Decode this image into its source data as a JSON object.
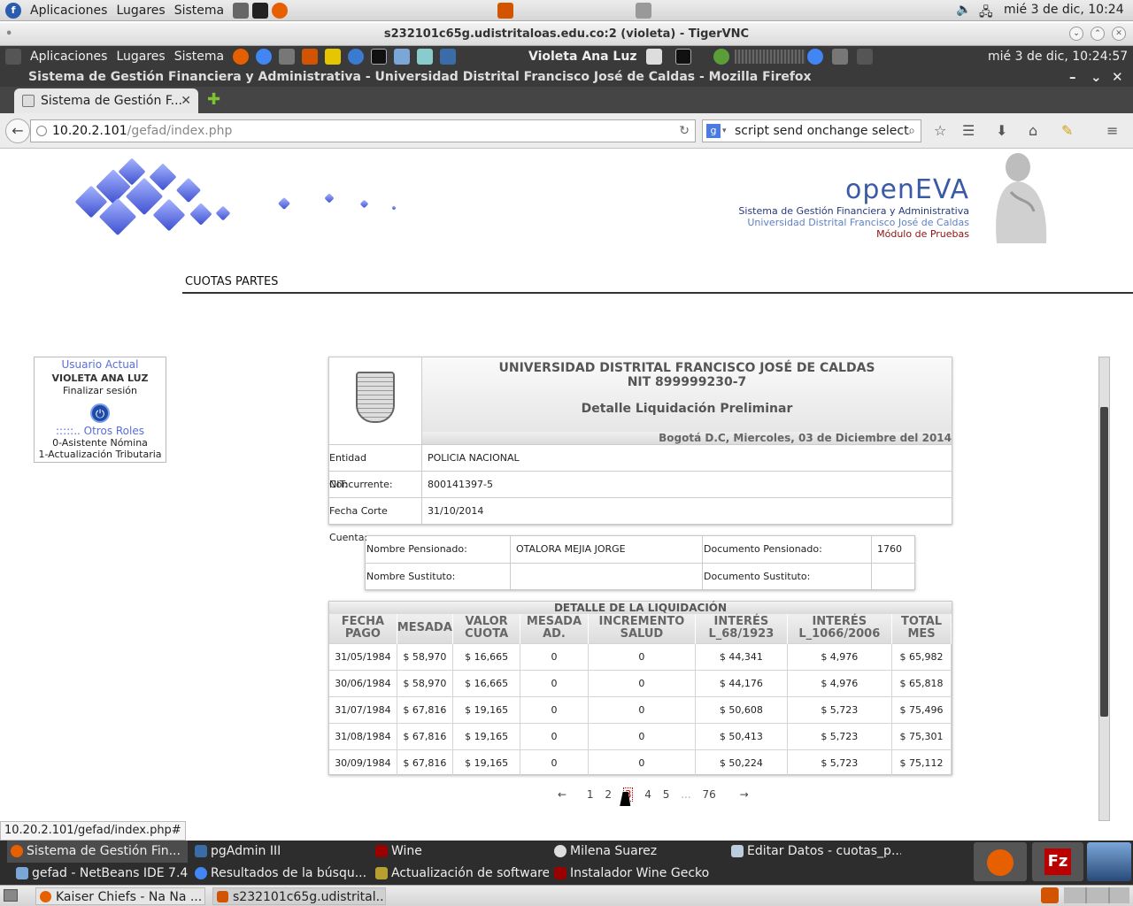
{
  "system_top_panel": {
    "menus": [
      "Aplicaciones",
      "Lugares",
      "Sistema"
    ],
    "clock": "mié  3 de dic, 10:24"
  },
  "vnc_window": {
    "title": "s232101c65g.udistritaloas.edu.co:2 (violeta) - TigerVNC"
  },
  "remote_panel": {
    "menus": [
      "Aplicaciones",
      "Lugares",
      "Sistema"
    ],
    "user": "Violeta Ana Luz",
    "clock": "mié  3 de dic, 10:24:57"
  },
  "firefox": {
    "window_title": "Sistema de Gestión Financiera y Administrativa - Universidad Distrital Francisco José de Caldas - Mozilla Firefox",
    "tab_label": "Sistema de Gestión F...",
    "url_host": "10.20.2.101",
    "url_path": "/gefad/index.php",
    "search_value": "script send onchange select",
    "status_url": "10.20.2.101/gefad/index.php#"
  },
  "page": {
    "brand": {
      "name": "openEVA",
      "line1": "Sistema de Gestión Financiera y Administrativa",
      "line2": "Universidad Distrital Francisco José de Caldas",
      "line3": "Módulo de Pruebas"
    },
    "section_title": "CUOTAS PARTES",
    "user_box": {
      "heading": "Usuario Actual",
      "name": "VIOLETA ANA LUZ",
      "logout": "Finalizar sesión",
      "roles_heading": ":::::.. Otros Roles",
      "roles": [
        "0-Asistente Nómina",
        "1-Actualización Tributaria"
      ]
    },
    "report": {
      "university": "UNIVERSIDAD DISTRITAL FRANCISCO JOSÉ DE CALDAS",
      "nit_line": "NIT 899999230-7",
      "subtitle": "Detalle Liquidación Preliminar",
      "date_line": "Bogotá D.C, Miercoles, 03 de Diciembre del 2014",
      "fields": [
        {
          "label": "Entidad Concurrente:",
          "value": "POLICIA NACIONAL"
        },
        {
          "label": "NIT:",
          "value": "800141397-5"
        },
        {
          "label": "Fecha Corte Cuenta:",
          "value": "31/10/2014"
        }
      ],
      "pensioner": {
        "name_label": "Nombre Pensionado:",
        "name_value": "OTALORA MEJIA JORGE",
        "doc_label": "Documento Pensionado:",
        "doc_value": "1760",
        "sub_name_label": "Nombre Sustituto:",
        "sub_name_value": "",
        "sub_doc_label": "Documento Sustituto:",
        "sub_doc_value": ""
      },
      "detail_caption": "DETALLE DE LA LIQUIDACIÓN",
      "columns": [
        "FECHA PAGO",
        "MESADA",
        "VALOR CUOTA",
        "MESADA AD.",
        "INCREMENTO SALUD",
        "INTERÉS L_68/1923",
        "INTERÉS L_1066/2006",
        "TOTAL MES"
      ],
      "rows": [
        [
          "31/05/1984",
          "$ 58,970",
          "$ 16,665",
          "0",
          "0",
          "$ 44,341",
          "$ 4,976",
          "$ 65,982"
        ],
        [
          "30/06/1984",
          "$ 58,970",
          "$ 16,665",
          "0",
          "0",
          "$ 44,176",
          "$ 4,976",
          "$ 65,818"
        ],
        [
          "31/07/1984",
          "$ 67,816",
          "$ 19,165",
          "0",
          "0",
          "$ 50,608",
          "$ 5,723",
          "$ 75,496"
        ],
        [
          "31/08/1984",
          "$ 67,816",
          "$ 19,165",
          "0",
          "0",
          "$ 50,413",
          "$ 5,723",
          "$ 75,301"
        ],
        [
          "30/09/1984",
          "$ 67,816",
          "$ 19,165",
          "0",
          "0",
          "$ 50,224",
          "$ 5,723",
          "$ 75,112"
        ]
      ]
    },
    "pager": {
      "prev": "←",
      "pages": [
        "1",
        "2",
        "3",
        "4",
        "5"
      ],
      "current": "3",
      "ellipsis": "...",
      "last": "76",
      "next": "→"
    }
  },
  "taskbar": {
    "row1": [
      "Sistema de Gestión Fin...",
      "pgAdmin III",
      "Wine",
      "Milena Suarez",
      "Editar Datos - cuotas_p..."
    ],
    "row2": [
      "gefad - NetBeans IDE 7.4",
      "Resultados de la búsqu...",
      "Actualización de software",
      "Instalador Wine Gecko"
    ]
  },
  "host_taskbar": {
    "items": [
      "Kaiser Chiefs - Na Na ...",
      "s232101c65g.udistrital..."
    ]
  }
}
